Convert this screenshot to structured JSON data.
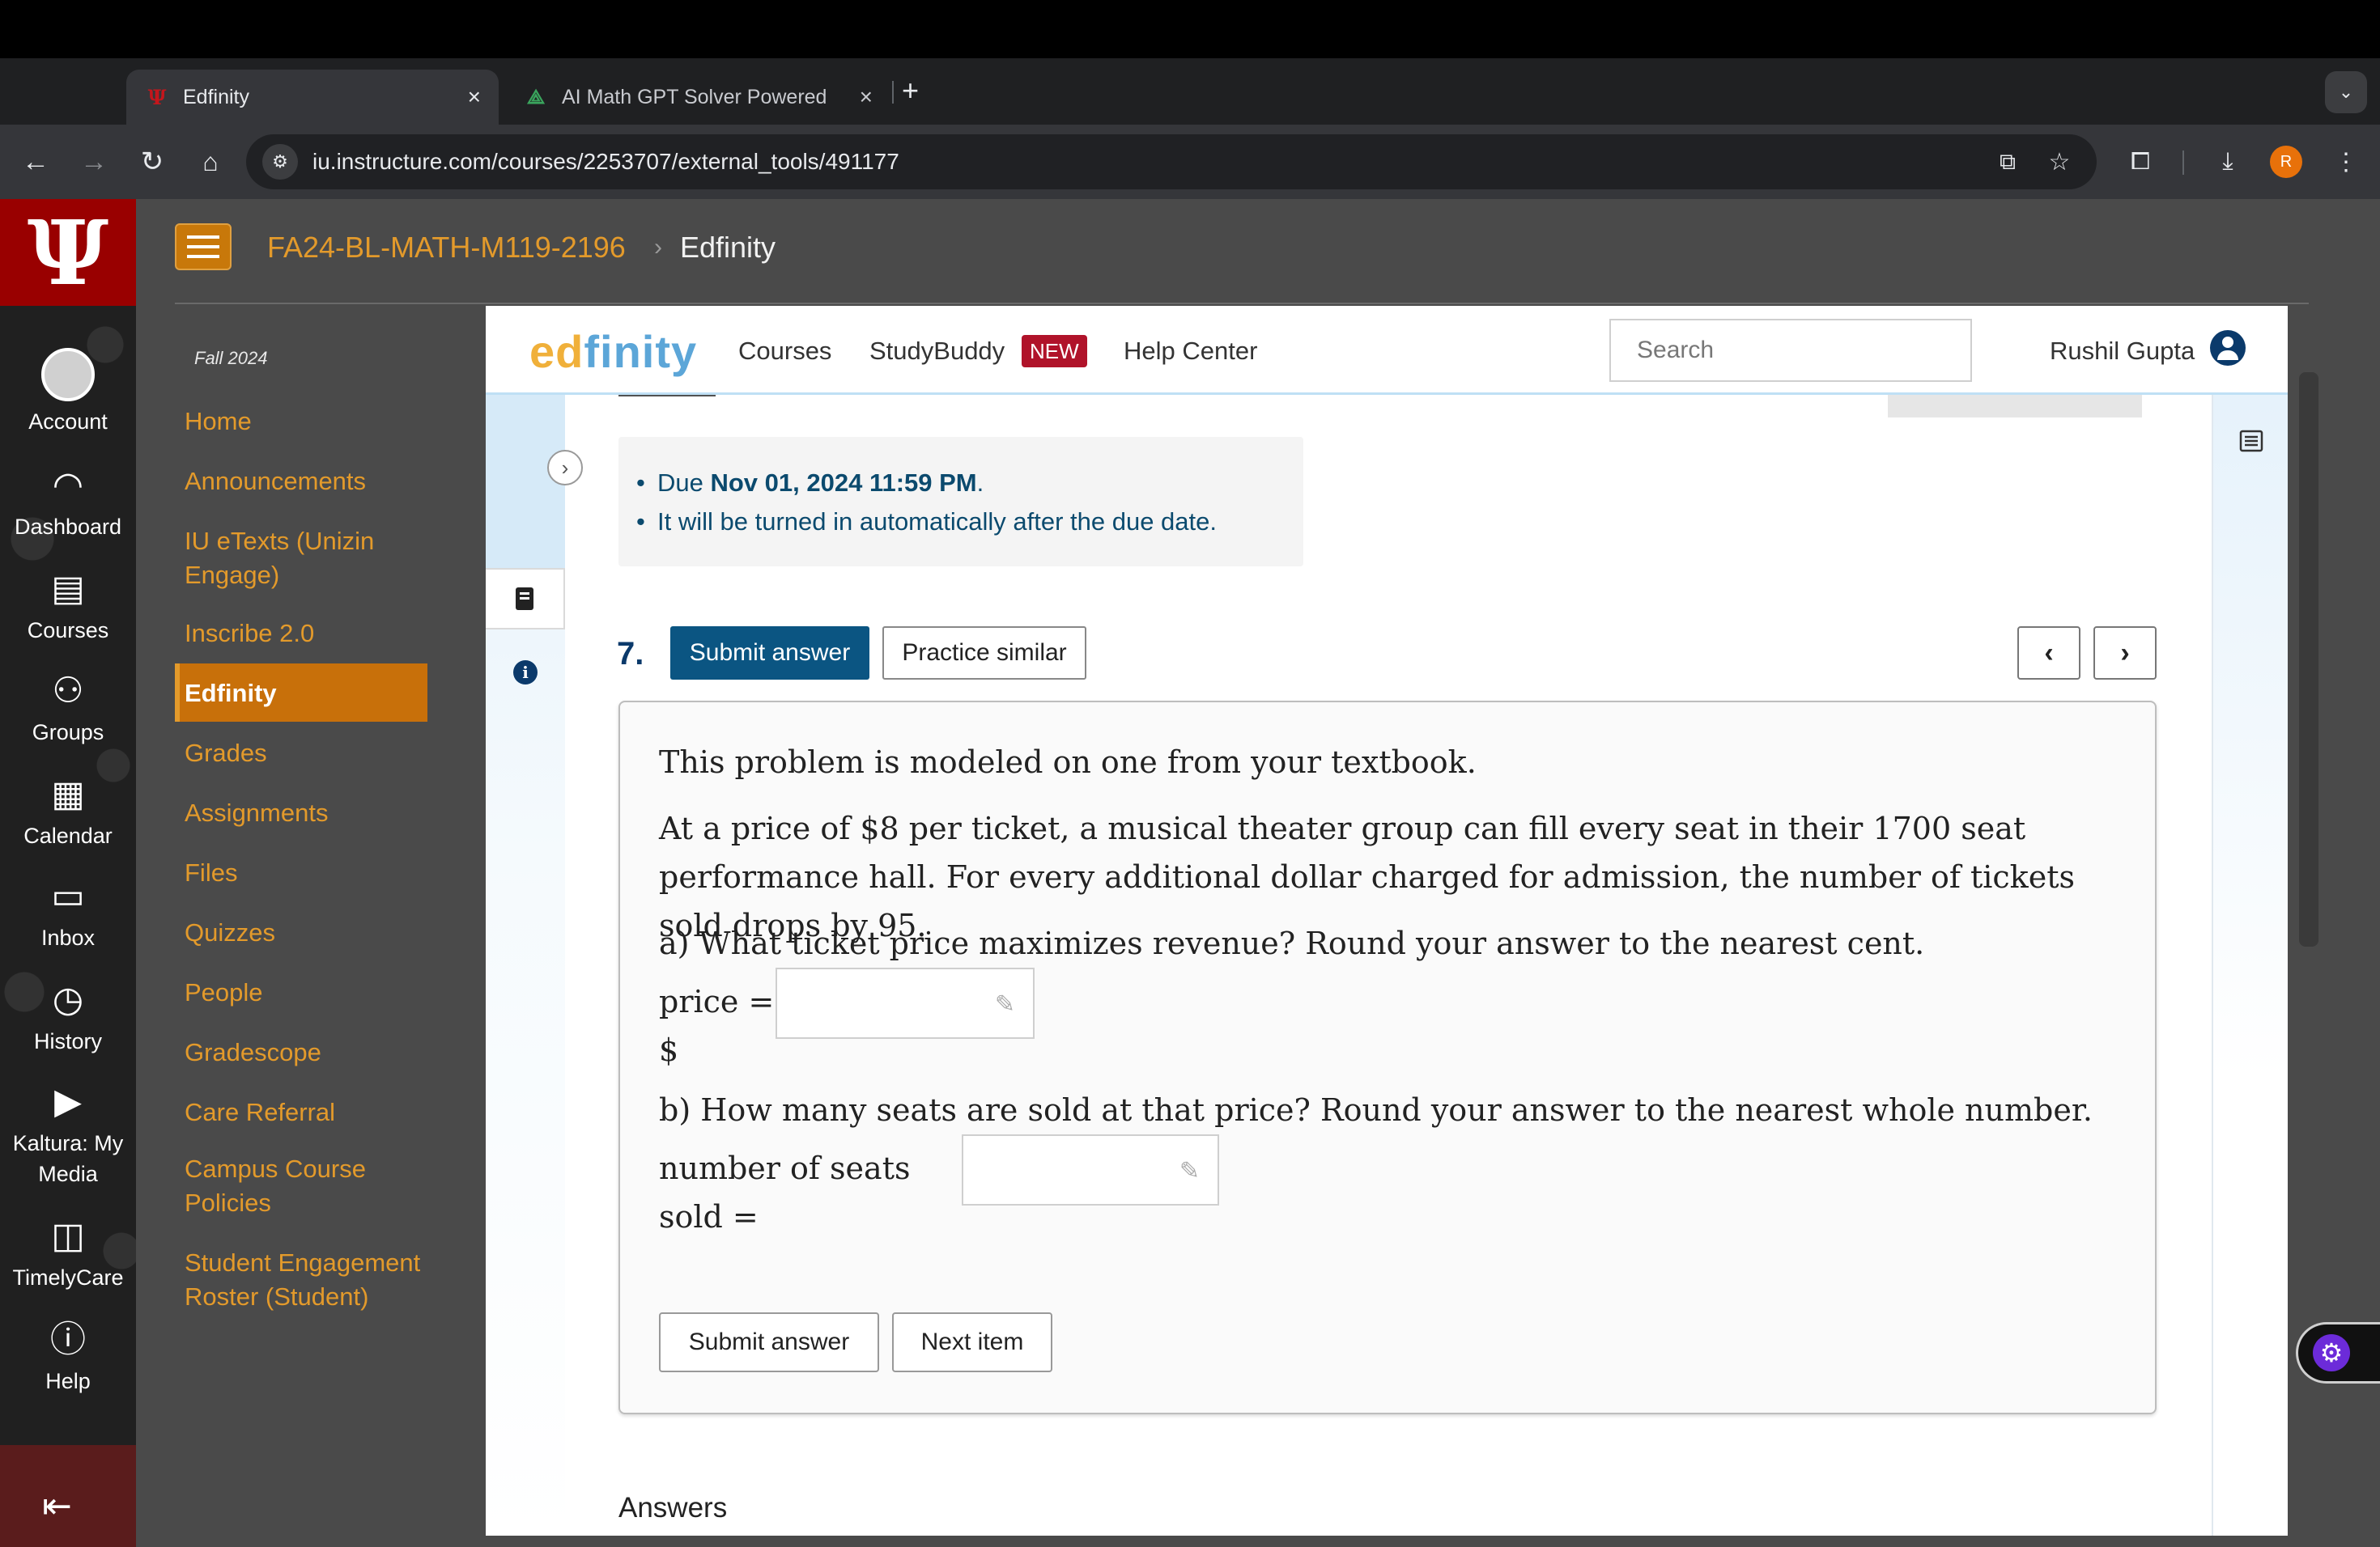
{
  "browser": {
    "tabs": [
      {
        "title": "Edfinity",
        "active": true,
        "favicon": "indiana-favicon"
      },
      {
        "title": "AI Math GPT Solver Powered",
        "active": false,
        "favicon": "mathgpt-favicon"
      }
    ],
    "url": "iu.instructure.com/courses/2253707/external_tools/491177",
    "profile_initial": "R"
  },
  "global_nav": {
    "items": [
      {
        "label": "Account",
        "icon": "account-icon"
      },
      {
        "label": "Dashboard",
        "icon": "dashboard-icon"
      },
      {
        "label": "Courses",
        "icon": "courses-icon"
      },
      {
        "label": "Groups",
        "icon": "groups-icon"
      },
      {
        "label": "Calendar",
        "icon": "calendar-icon"
      },
      {
        "label": "Inbox",
        "icon": "inbox-icon"
      },
      {
        "label": "History",
        "icon": "history-icon"
      },
      {
        "label": "Kaltura: My Media",
        "icon": "kaltura-icon"
      },
      {
        "label": "TimelyCare",
        "icon": "timelycare-icon"
      },
      {
        "label": "Help",
        "icon": "help-icon"
      }
    ],
    "brand_color": "#990000"
  },
  "course_header": {
    "course": "FA24-BL-MATH-M119-2196",
    "separator": "›",
    "page": "Edfinity"
  },
  "course_nav": {
    "term": "Fall 2024",
    "items": [
      {
        "label": "Home"
      },
      {
        "label": "Announcements"
      },
      {
        "label": "IU eTexts (Unizin Engage)"
      },
      {
        "label": "Inscribe 2.0"
      },
      {
        "label": "Edfinity",
        "active": true
      },
      {
        "label": "Grades"
      },
      {
        "label": "Assignments"
      },
      {
        "label": "Files"
      },
      {
        "label": "Quizzes"
      },
      {
        "label": "People"
      },
      {
        "label": "Gradescope"
      },
      {
        "label": "Care Referral"
      },
      {
        "label": "Campus Course Policies"
      },
      {
        "label": "Student Engagement Roster (Student)"
      }
    ],
    "accent_color": "#e39a2b"
  },
  "edfinity": {
    "logo_ed": "ed",
    "logo_finity": "finity",
    "nav": {
      "courses": "Courses",
      "studybuddy": "StudyBuddy",
      "new_badge": "NEW",
      "help": "Help Center"
    },
    "search_placeholder": "Search",
    "user_name": "Rushil Gupta",
    "due": {
      "prefix": "Due ",
      "date": "Nov 01, 2024 11:59 PM",
      "suffix": ".",
      "note": "It will be turned in automatically after the due date."
    },
    "question": {
      "number": "7.",
      "submit_label": "Submit answer",
      "practice_label": "Practice similar",
      "intro": "This problem is modeled on one from your textbook.",
      "body": "At a price of $8 per ticket, a musical theater group can fill every seat in their 1700 seat performance hall. For every additional dollar charged for admission, the number of tickets sold drops by 95.",
      "part_a": "a) What ticket price maximizes revenue? Round your answer to the nearest cent.",
      "part_a_label": "price = $",
      "part_a_value": "",
      "part_b": "b) How many seats are sold at that price? Round your answer to the nearest whole number.",
      "part_b_label": "number of seats sold =",
      "part_b_value": "",
      "bottom_submit": "Submit answer",
      "next_item": "Next item"
    },
    "answers_heading": "Answers",
    "primary_color": "#0b5582"
  }
}
